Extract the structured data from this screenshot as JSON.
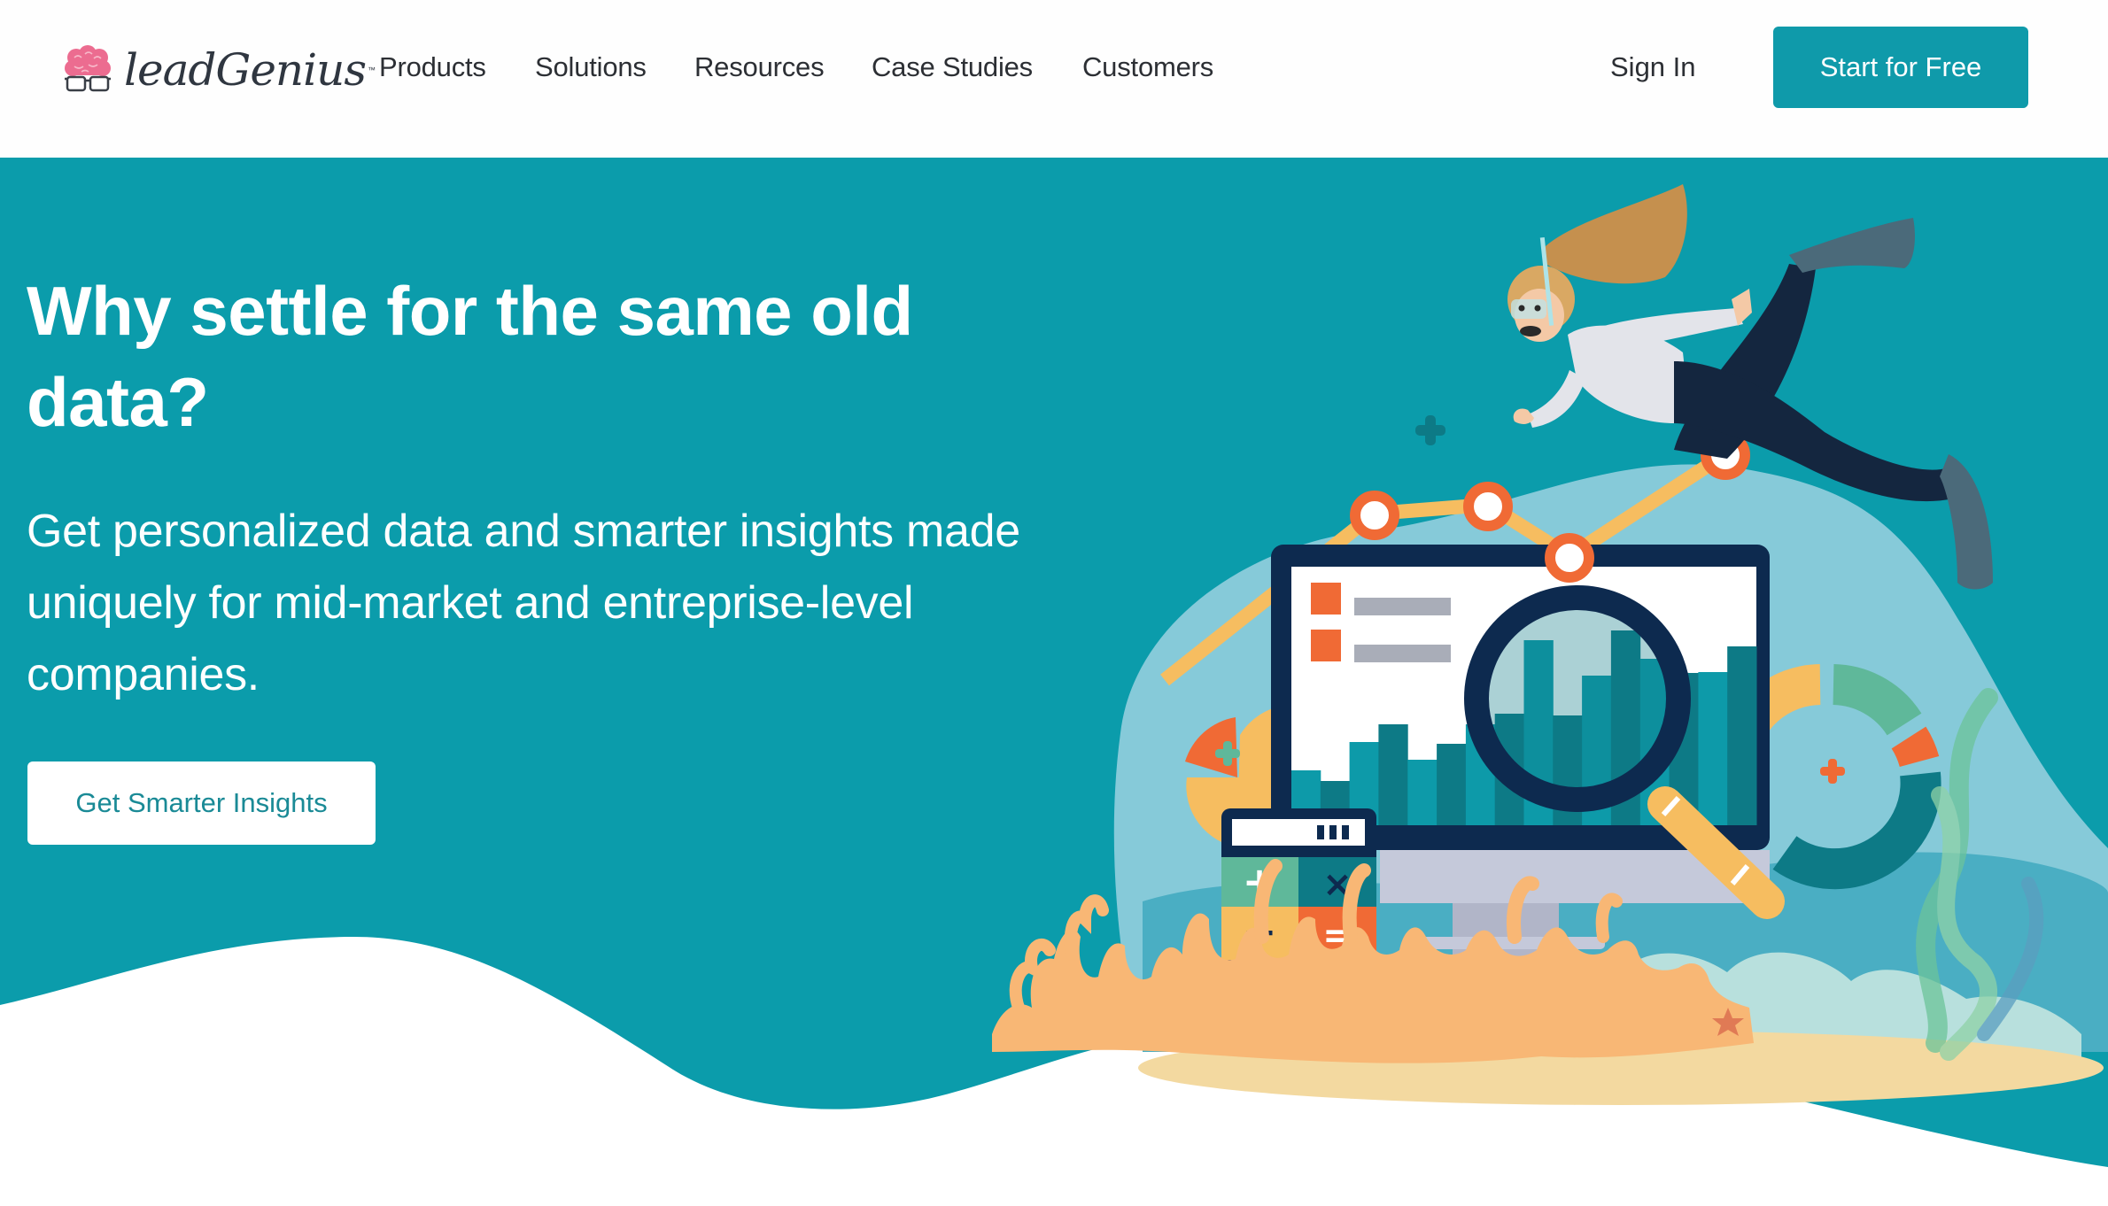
{
  "brand": {
    "name": "leadGenius",
    "trademark": "™"
  },
  "nav": {
    "items": [
      {
        "label": "Products"
      },
      {
        "label": "Solutions"
      },
      {
        "label": "Resources"
      },
      {
        "label": "Case Studies"
      },
      {
        "label": "Customers"
      }
    ],
    "sign_in": "Sign In",
    "cta": "Start for Free"
  },
  "hero": {
    "title": "Why settle for the same old data?",
    "subtitle": "Get personalized data and smarter insights made uniquely for mid-market and entreprise-level companies.",
    "cta": "Get Smarter Insights"
  },
  "illustration": {
    "description": "Snorkeling diver above a monitor showing bar chart with magnifying glass, line graph with circular markers, pie and donut charts, calculator, coral and seaweed",
    "calculator_keys": [
      "+",
      "×",
      "−",
      "="
    ]
  },
  "colors": {
    "brand_teal": "#0f9aaa",
    "hero_bg": "#0b9cab",
    "text_dark": "#2c2f34",
    "cta_text": "#1a8a96",
    "navy": "#0d2a4f",
    "orange": "#f06a35",
    "yellow": "#f6bd60",
    "coral": "#f8b775",
    "light_blue": "#86cad9",
    "brain_pink": "#ec6c90"
  }
}
